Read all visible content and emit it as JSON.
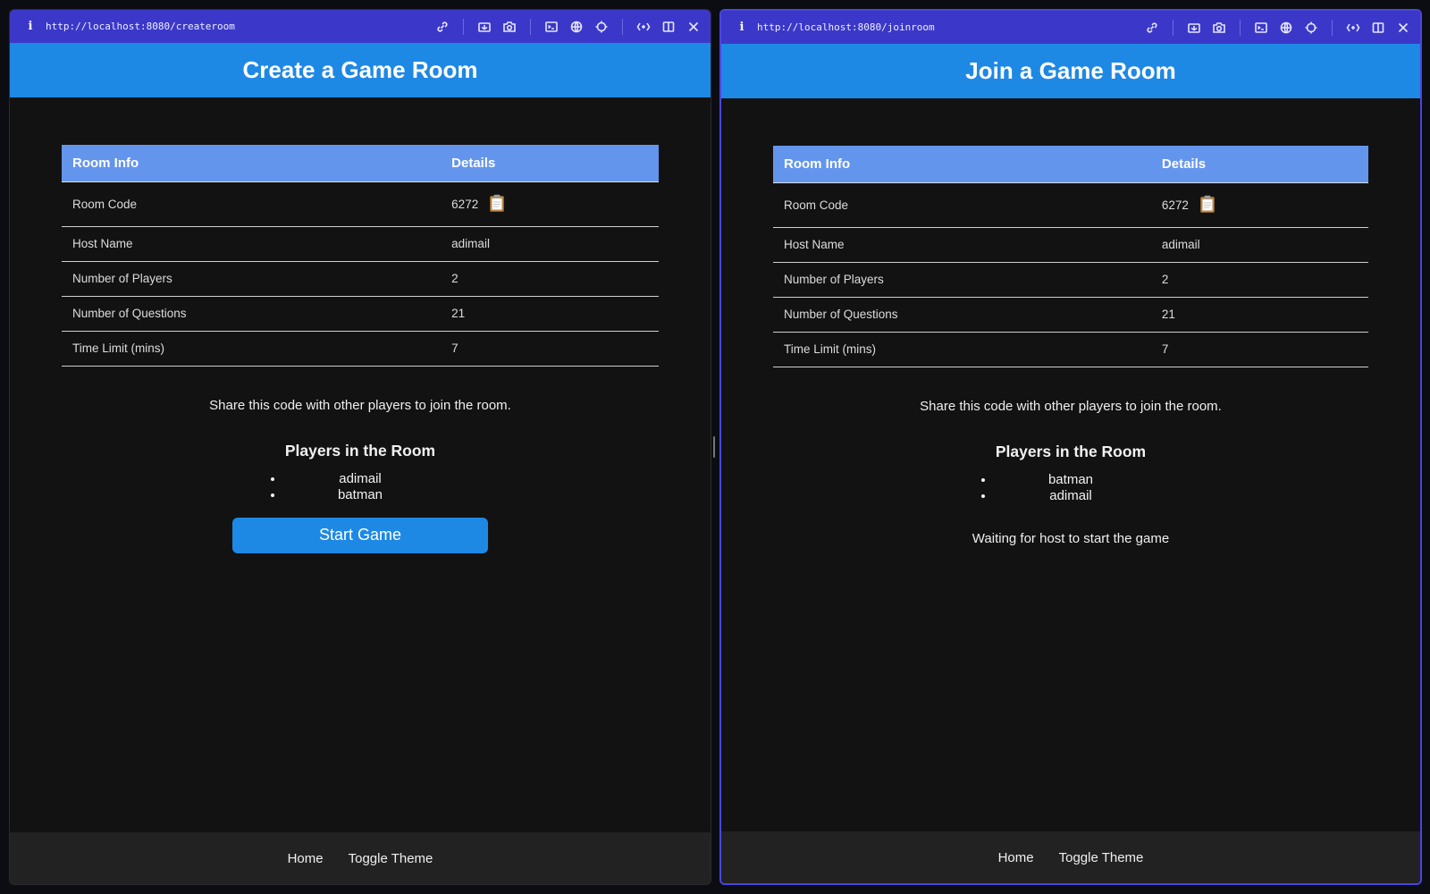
{
  "left": {
    "url": "http://localhost:8080/createroom",
    "title": "Create a Game Room",
    "table": {
      "headers": [
        "Room Info",
        "Details"
      ],
      "rows": [
        {
          "label": "Room Code",
          "value": "6272"
        },
        {
          "label": "Host Name",
          "value": "adimail"
        },
        {
          "label": "Number of Players",
          "value": "2"
        },
        {
          "label": "Number of Questions",
          "value": "21"
        },
        {
          "label": "Time Limit (mins)",
          "value": "7"
        }
      ]
    },
    "share_text": "Share this code with other players to join the room.",
    "players_heading": "Players in the Room",
    "players": [
      "adimail",
      "batman"
    ],
    "start_label": "Start Game",
    "footer": {
      "home": "Home",
      "toggle": "Toggle Theme"
    }
  },
  "right": {
    "url": "http://localhost:8080/joinroom",
    "title": "Join a Game Room",
    "table": {
      "headers": [
        "Room Info",
        "Details"
      ],
      "rows": [
        {
          "label": "Room Code",
          "value": "6272"
        },
        {
          "label": "Host Name",
          "value": "adimail"
        },
        {
          "label": "Number of Players",
          "value": "2"
        },
        {
          "label": "Number of Questions",
          "value": "21"
        },
        {
          "label": "Time Limit (mins)",
          "value": "7"
        }
      ]
    },
    "share_text": "Share this code with other players to join the room.",
    "players_heading": "Players in the Room",
    "players": [
      "batman",
      "adimail"
    ],
    "waiting_text": "Waiting for host to start the game",
    "footer": {
      "home": "Home",
      "toggle": "Toggle Theme"
    }
  },
  "colors": {
    "header_bg": "#1e88e5",
    "table_header_bg": "#6495ed",
    "urlbar_bg": "#3b38c9",
    "page_bg": "#121212",
    "footer_bg": "#222222"
  },
  "icons": {
    "urlbar_tools": [
      "link-icon",
      "screenshot-icon",
      "camera-icon",
      "terminal-icon",
      "globe-icon",
      "crosshair-icon",
      "devices-icon",
      "split-view-icon",
      "close-icon"
    ],
    "copy": "clipboard-icon"
  }
}
